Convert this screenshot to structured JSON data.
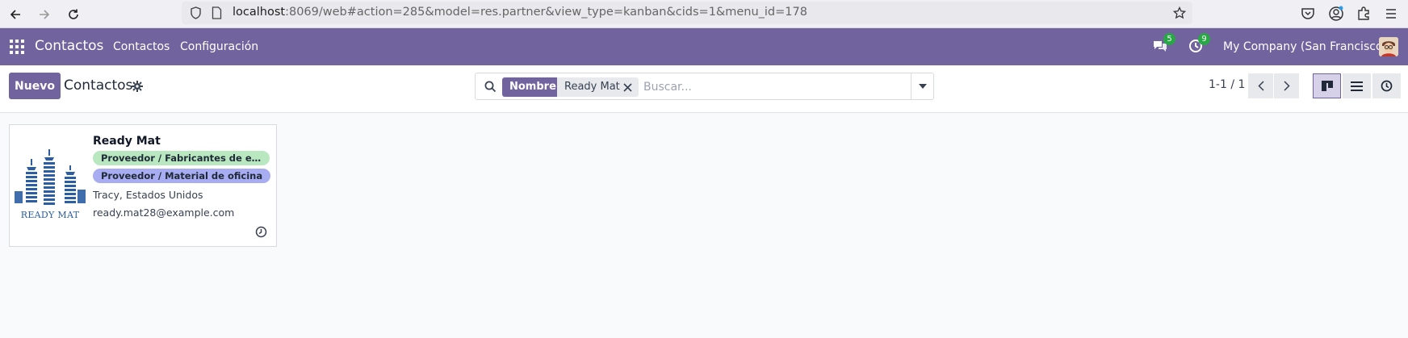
{
  "browser": {
    "url_host": "localhost",
    "url_rest": ":8069/web#action=285&model=res.partner&view_type=kanban&cids=1&menu_id=178"
  },
  "navbar": {
    "app_name": "Contactos",
    "menu": [
      "Contactos",
      "Configuración"
    ],
    "messages_count": "5",
    "activities_count": "9",
    "company": "My Company (San Francisco)"
  },
  "control": {
    "new_label": "Nuevo",
    "title": "Contactos",
    "facet_name": "Nombre",
    "facet_value": "Ready Mat",
    "search_placeholder": "Buscar...",
    "pager": "1-1 / 1"
  },
  "cards": [
    {
      "name": "Ready Mat",
      "logo_text": "READY MAT",
      "tags": [
        {
          "label": "Proveedor / Fabricantes de escrit...",
          "color": "#b8e7c0"
        },
        {
          "label": "Proveedor / Material de oficina",
          "color": "#a8acf0"
        }
      ],
      "location": "Tracy, Estados Unidos",
      "email": "ready.mat28@example.com"
    }
  ],
  "colors": {
    "brand": "#71639e",
    "badge": "#28a745",
    "logo_blue": "#2b5ea3"
  }
}
